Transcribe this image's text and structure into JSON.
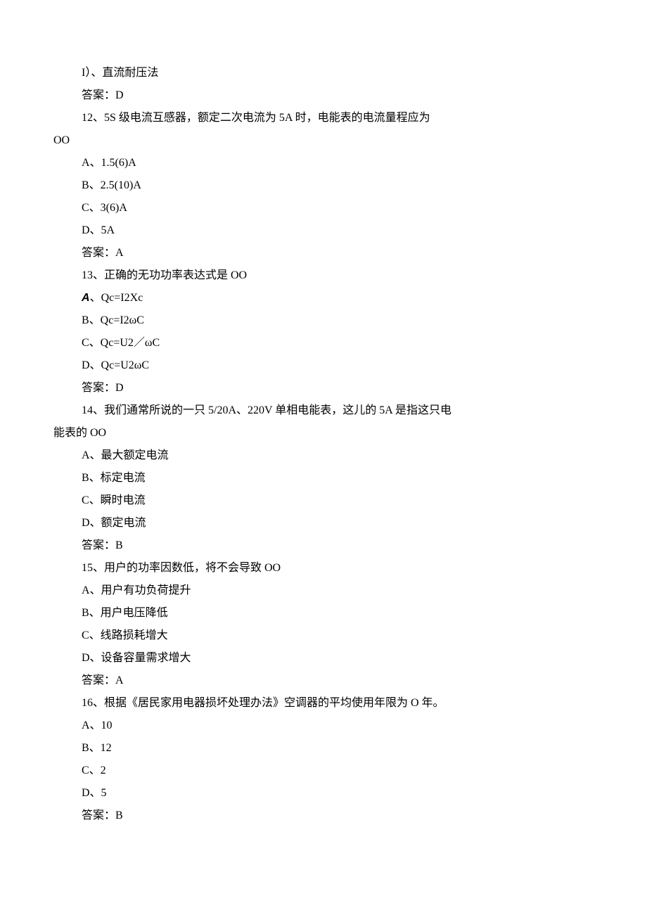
{
  "lines": [
    {
      "cls": "line",
      "text": "I）、直流耐压法"
    },
    {
      "cls": "line",
      "text": "答案：D"
    },
    {
      "cls": "line",
      "text": "12、5S 级电流互感器，额定二次电流为 5A 时，电能表的电流量程应为"
    },
    {
      "cls": "line-noindent",
      "text": "OO"
    },
    {
      "cls": "line",
      "text": "A、1.5(6)A"
    },
    {
      "cls": "line",
      "text": "B、2.5(10)A"
    },
    {
      "cls": "line",
      "text": "C、3(6)A"
    },
    {
      "cls": "line",
      "text": "D、5A"
    },
    {
      "cls": "line",
      "text": "答案：A"
    },
    {
      "cls": "line",
      "text": "13、正确的无功功率表达式是 OO"
    },
    {
      "cls": "line",
      "prefix": "A",
      "prefixClass": "bolditalic",
      "text": "、Qc=I2Xc"
    },
    {
      "cls": "line",
      "text": "B、Qc=I2ωC"
    },
    {
      "cls": "line",
      "text": "C、Qc=U2／ωC"
    },
    {
      "cls": "line",
      "text": "D、Qc=U2ωC"
    },
    {
      "cls": "line",
      "text": "答案：D"
    },
    {
      "cls": "line",
      "text": "14、我们通常所说的一只 5/20A、220V 单相电能表，这儿的 5A 是指这只电"
    },
    {
      "cls": "line-noindent",
      "text": "能表的 OO"
    },
    {
      "cls": "line",
      "text": "A、最大额定电流"
    },
    {
      "cls": "line",
      "text": "B、标定电流"
    },
    {
      "cls": "line",
      "text": "C、瞬时电流"
    },
    {
      "cls": "line",
      "text": "D、额定电流"
    },
    {
      "cls": "line",
      "text": "答案：B"
    },
    {
      "cls": "line",
      "text": "15、用户的功率因数低，将不会导致 OO"
    },
    {
      "cls": "line",
      "text": "A、用户有功负荷提升"
    },
    {
      "cls": "line",
      "text": "B、用户电压降低"
    },
    {
      "cls": "line",
      "text": "C、线路损耗增大"
    },
    {
      "cls": "line",
      "text": "D、设备容量需求增大"
    },
    {
      "cls": "line",
      "text": "答案：A"
    },
    {
      "cls": "line",
      "text": "16、根据《居民家用电器损坏处理办法》空调器的平均使用年限为 O 年。"
    },
    {
      "cls": "line",
      "text": "A、10"
    },
    {
      "cls": "line",
      "text": "B、12"
    },
    {
      "cls": "line",
      "text": "C、2"
    },
    {
      "cls": "line",
      "text": "D、5"
    },
    {
      "cls": "line",
      "text": "答案：B"
    }
  ]
}
